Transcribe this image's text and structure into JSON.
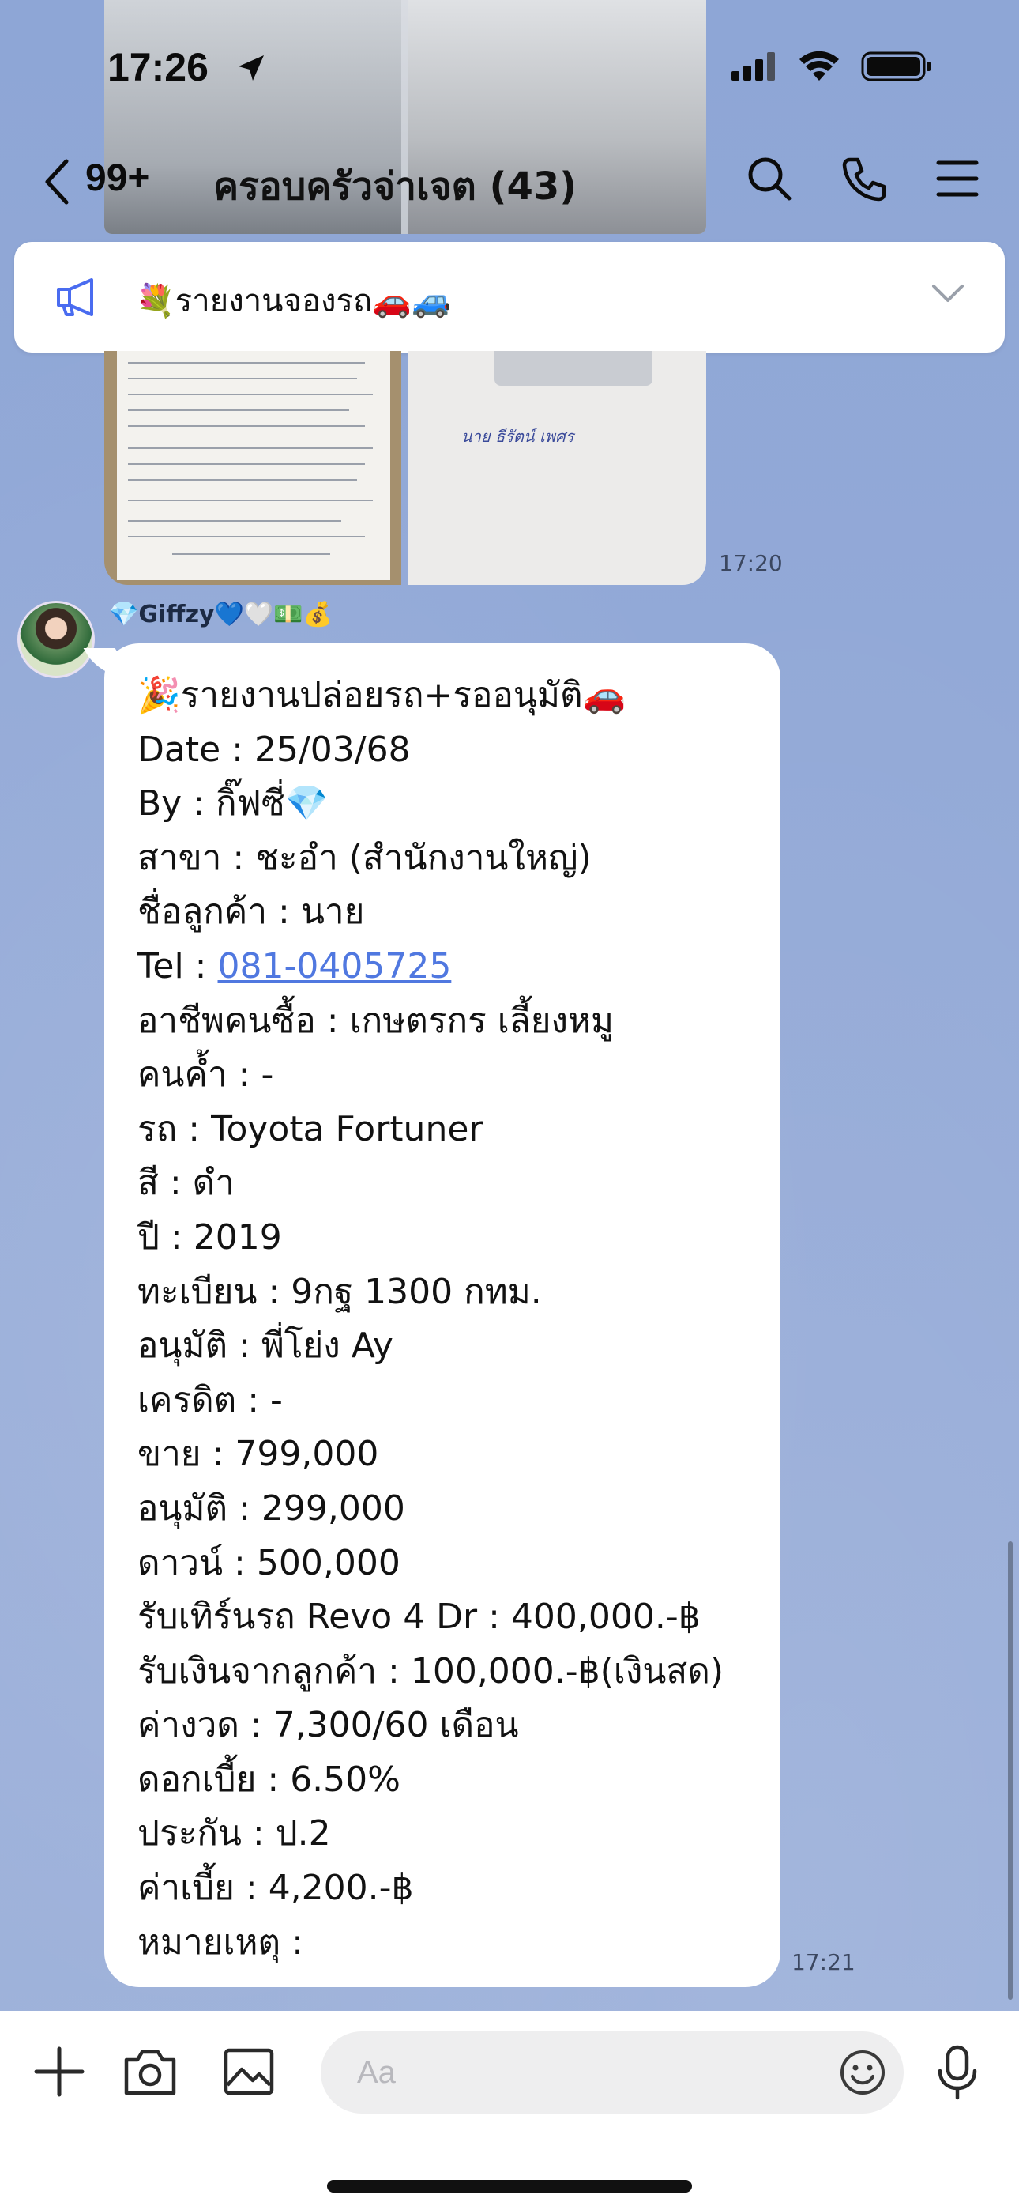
{
  "status_bar": {
    "time": "17:26"
  },
  "header": {
    "back_count": "99+",
    "title": "ครอบครัวจ่าเจต (43)"
  },
  "announcement": {
    "text": "💐รายงานจองรถ🚗🚙"
  },
  "photos": {
    "signature_text": "นาย ธีรัตน์ เพศร"
  },
  "messages": {
    "photo_time": "17:20",
    "sender_name": "💎Giffzy💙🤍💵💰",
    "text_time": "17:21",
    "lines": [
      "🎉รายงานปล่อยรถ+รออนุมัติ🚗",
      "Date : 25/03/68",
      "By : กิ๊ฟซี่💎",
      "สาขา : ชะอำ (สำนักงานใหญ่)",
      "ชื่อลูกค้า : นาย",
      "Tel : ",
      "อาชีพคนซื้อ : เกษตรกร เลี้ยงหมู",
      "คนค้ำ : -",
      "รถ : Toyota Fortuner",
      "สี : ดำ",
      "ปี : 2019",
      "ทะเบียน : 9กฐ 1300 กทม.",
      "อนุมัติ : พี่โย่ง Ay",
      "เครดิต : -",
      "ขาย : 799,000",
      "อนุมัติ : 299,000",
      "ดาวน์ : 500,000",
      "รับเทิร์นรถ Revo 4 Dr : 400,000.-฿",
      "รับเงินจากลูกค้า : 100,000.-฿(เงินสด)",
      "ค่างวด : 7,300/60 เดือน",
      "ดอกเบี้ย : 6.50%",
      "ประกัน : ป.2",
      "ค่าเบี้ย : 4,200.-฿",
      "หมายเหตุ :"
    ],
    "phone_link": "081-0405725"
  },
  "input": {
    "placeholder": "Aa"
  }
}
